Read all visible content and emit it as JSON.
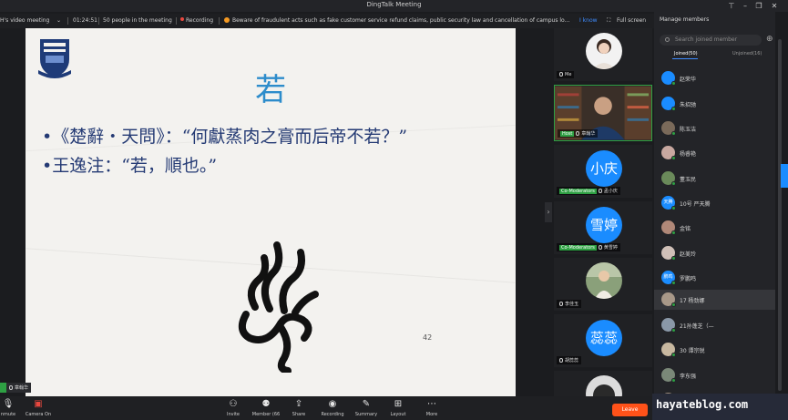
{
  "window": {
    "title": "DingTalk Meeting"
  },
  "infobar": {
    "meeting_name": "H's video meeting",
    "duration": "01:24:51",
    "people": "50 people in the meeting",
    "recording": "Recording",
    "notice": "Beware of fraudulent acts such as fake customer service refund claims, public security law and cancellation of campus lo...",
    "i_know": "I know",
    "full_screen": "Full screen"
  },
  "slide": {
    "title": "若",
    "bullet1": "•《楚辭・天問》：“何獻蒸肉之膏而后帝不若？”",
    "bullet2": "•王逸注：“若，順也。”",
    "page_number": "42"
  },
  "speaker_chip": {
    "name": "章翰华"
  },
  "participants": [
    {
      "label": "Me",
      "role": "",
      "avatar_text": ""
    },
    {
      "label": "章翰华",
      "role": "Host",
      "avatar_text": ""
    },
    {
      "label": "孟小庆",
      "role": "Co-Moderators",
      "avatar_text": "小庆"
    },
    {
      "label": "黄雪婷",
      "role": "Co-Moderators",
      "avatar_text": "雪婷"
    },
    {
      "label": "李佳玉",
      "role": "",
      "avatar_text": ""
    },
    {
      "label": "胡蕊蕊",
      "role": "",
      "avatar_text": "蕊蕊"
    }
  ],
  "members_panel": {
    "title": "Manage members",
    "search_placeholder": "Search joined member",
    "tab_joined": "Joined(50)",
    "tab_unjoined": "Unjoined(16)",
    "members": [
      {
        "name": "赵荣华",
        "avatar": ""
      },
      {
        "name": "朱招驰",
        "avatar": ""
      },
      {
        "name": "陈玉洁",
        "avatar": ""
      },
      {
        "name": "杨睿艳",
        "avatar": ""
      },
      {
        "name": "董玉民",
        "avatar": ""
      },
      {
        "name": "10号 严天腾",
        "avatar": "天腾"
      },
      {
        "name": "金铭",
        "avatar": ""
      },
      {
        "name": "赵美玲",
        "avatar": ""
      },
      {
        "name": "罗鹏鸣",
        "avatar": "鹏鸣"
      },
      {
        "name": "17 杨劲娜",
        "avatar": ""
      },
      {
        "name": "21孙蓬芝（—",
        "avatar": ""
      },
      {
        "name": "30 谭宗锐",
        "avatar": ""
      },
      {
        "name": "李东强",
        "avatar": ""
      },
      {
        "name": "",
        "avatar": ""
      }
    ]
  },
  "toolbar": {
    "unmute": "nmute",
    "camera": "Camera On",
    "invite": "Invite",
    "member": "Member (66",
    "share": "Share",
    "recording": "Recording",
    "summary": "Summary",
    "layout": "Layout",
    "more": "More",
    "leave": "Leave"
  },
  "watermark": {
    "text": "hayateblog.com"
  },
  "colors": {
    "accent": "#1a8cff",
    "host_green": "#2ea043",
    "leave": "#ff5219",
    "slide_title": "#2d8ccb",
    "slide_text": "#243a74"
  }
}
